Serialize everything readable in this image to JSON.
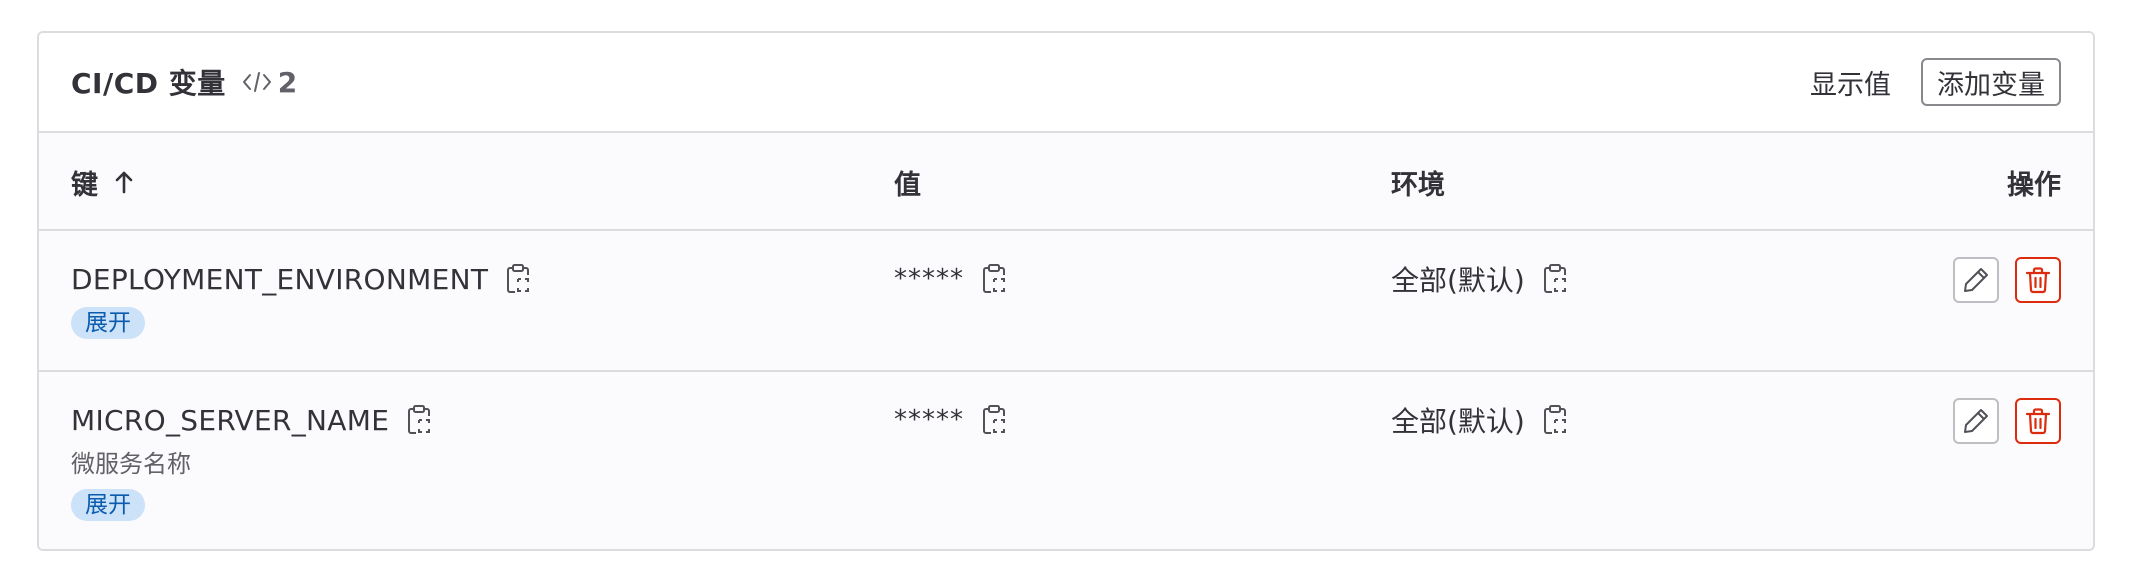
{
  "header": {
    "title": "CI/CD 变量",
    "count": "2",
    "reveal_label": "显示值",
    "add_label": "添加变量"
  },
  "columns": {
    "key": "键",
    "value": "值",
    "environment": "环境",
    "actions": "操作"
  },
  "rows": [
    {
      "key": "DEPLOYMENT_ENVIRONMENT",
      "description": "",
      "badge": "展开",
      "value": "*****",
      "environment": "全部(默认)"
    },
    {
      "key": "MICRO_SERVER_NAME",
      "description": "微服务名称",
      "badge": "展开",
      "value": "*****",
      "environment": "全部(默认)"
    }
  ],
  "icons": {
    "count": "code-icon",
    "sort": "arrow-up-icon",
    "copy": "clipboard-icon",
    "edit": "pencil-icon",
    "delete": "trash-icon"
  },
  "colors": {
    "badge_bg": "#cbe2f9",
    "badge_text": "#0b5cad",
    "danger": "#dd2b0e",
    "border": "#dcdcde"
  }
}
